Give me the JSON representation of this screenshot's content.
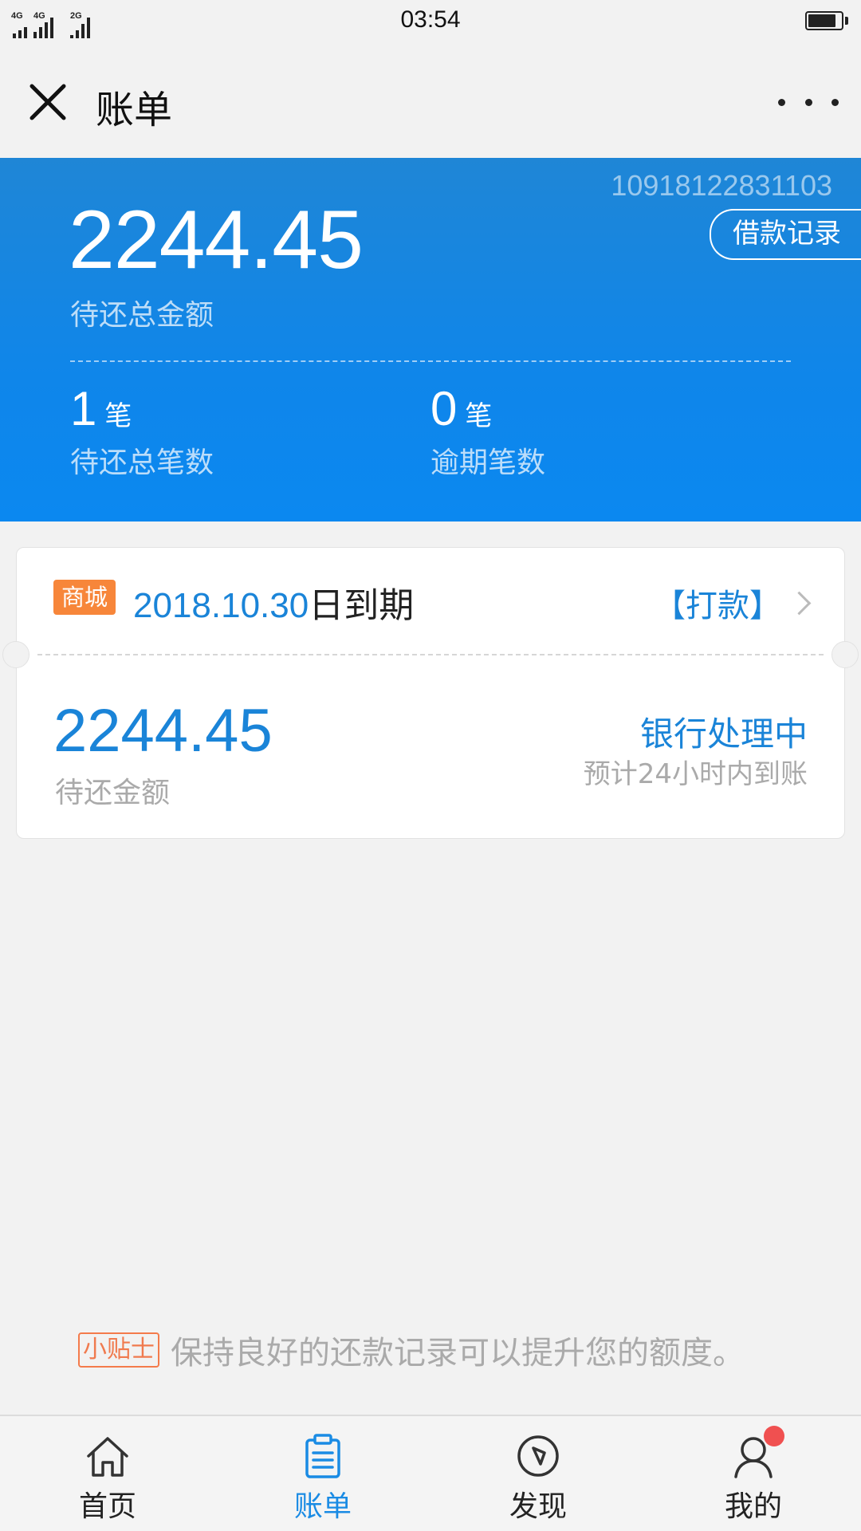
{
  "status_bar": {
    "time": "03:54",
    "signal_labels": [
      "4G",
      "4G",
      "2G"
    ]
  },
  "header": {
    "title": "账单"
  },
  "summary": {
    "account_number": "10918122831103",
    "loan_record_button": "借款记录",
    "total_amount": "2244.45",
    "total_amount_label": "待还总金额",
    "pending_count": "1",
    "pending_unit": "笔",
    "pending_label": "待还总笔数",
    "overdue_count": "0",
    "overdue_unit": "笔",
    "overdue_label": "逾期笔数"
  },
  "bill": {
    "tag": "商城",
    "due_date": "2018.10.30",
    "due_suffix": "日到期",
    "pay_link": "【打款】",
    "amount": "2244.45",
    "amount_label": "待还金额",
    "status": "银行处理中",
    "eta": "预计24小时内到账"
  },
  "tip": {
    "tag": "小贴士",
    "text": "保持良好的还款记录可以提升您的额度。"
  },
  "nav": {
    "items": [
      {
        "label": "首页",
        "icon": "home-icon"
      },
      {
        "label": "账单",
        "icon": "bill-icon"
      },
      {
        "label": "发现",
        "icon": "compass-icon"
      },
      {
        "label": "我的",
        "icon": "user-icon"
      }
    ],
    "active_index": 1
  },
  "colors": {
    "summary_blue": "#0f86ea",
    "accent_blue": "#1a84d8",
    "tag_orange": "#f7863a",
    "tip_orange": "#f07a4e",
    "badge_red": "#f05050"
  }
}
